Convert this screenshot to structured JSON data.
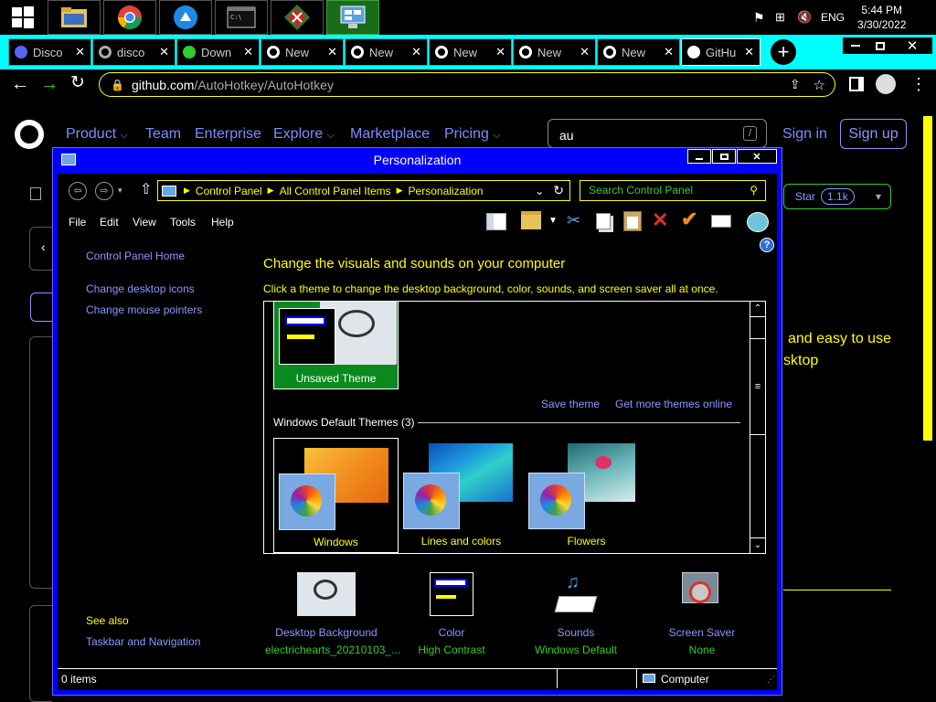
{
  "taskbar": {
    "tray": {
      "time": "5:44 PM",
      "date": "3/30/2022",
      "lang": "ENG"
    }
  },
  "browser": {
    "tabs": [
      {
        "label": "Disco",
        "icon": "discord-icon",
        "color": "#5865f2"
      },
      {
        "label": "disco",
        "icon": "globe-icon",
        "color": "#aaaaaa"
      },
      {
        "label": "Down",
        "icon": "download-icon",
        "color": "#2ecc2e"
      },
      {
        "label": "New",
        "icon": "chrome-icon",
        "color": "#ffffff"
      },
      {
        "label": "New",
        "icon": "chrome-icon",
        "color": "#ffffff"
      },
      {
        "label": "New",
        "icon": "chrome-icon",
        "color": "#ffffff"
      },
      {
        "label": "New",
        "icon": "chrome-icon",
        "color": "#ffffff"
      },
      {
        "label": "New",
        "icon": "chrome-icon",
        "color": "#ffffff"
      },
      {
        "label": "GitHu",
        "icon": "github-icon",
        "color": "#ffffff"
      }
    ],
    "url_domain": "github.com",
    "url_path": "/AutoHotkey/AutoHotkey"
  },
  "github": {
    "nav": [
      "Product",
      "Team",
      "Enterprise",
      "Explore",
      "Marketplace",
      "Pricing"
    ],
    "search_value": "au",
    "search_key": "/",
    "sign_in": "Sign in",
    "sign_up": "Sign up",
    "star_label": "Star",
    "star_count": "1.1k",
    "text_line1": "and easy to use",
    "text_line2": "sktop"
  },
  "window": {
    "title": "Personalization",
    "breadcrumb": [
      "Control Panel",
      "All Control Panel Items",
      "Personalization"
    ],
    "search_placeholder": "Search Control Panel",
    "menu": [
      "File",
      "Edit",
      "View",
      "Tools",
      "Help"
    ],
    "left_links": [
      "Control Panel Home",
      "Change desktop icons",
      "Change mouse pointers"
    ],
    "see_also": "See also",
    "see_also_link": "Taskbar and Navigation",
    "heading": "Change the visuals and sounds on your computer",
    "subheading": "Click a theme to change the desktop background, color, sounds, and screen saver all at once.",
    "unsaved_theme": "Unsaved Theme",
    "save_theme": "Save theme",
    "get_more": "Get more themes online",
    "default_group": "Windows Default Themes (3)",
    "themes": [
      "Windows",
      "Lines and colors",
      "Flowers"
    ],
    "bottom_items": [
      {
        "label": "Desktop Background",
        "value": "electrichearts_20210103_..."
      },
      {
        "label": "Color",
        "value": "High Contrast"
      },
      {
        "label": "Sounds",
        "value": "Windows Default"
      },
      {
        "label": "Screen Saver",
        "value": "None"
      }
    ],
    "status_items": "0 items",
    "status_location": "Computer"
  }
}
